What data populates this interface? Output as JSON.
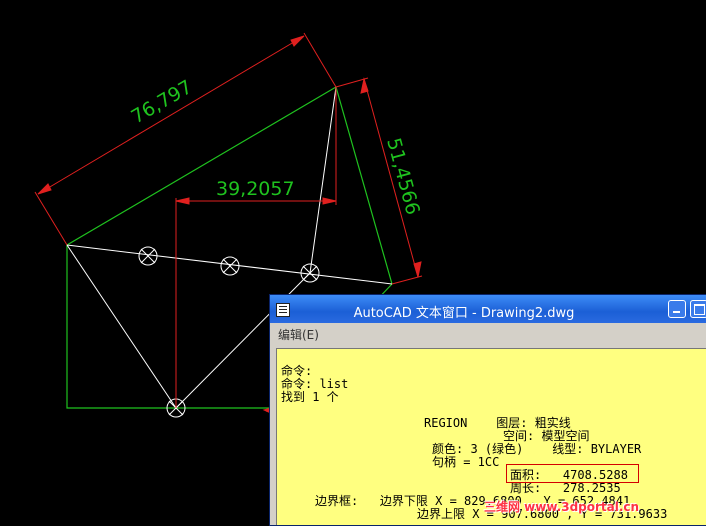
{
  "drawing": {
    "dimensions": {
      "long_side": "76,797",
      "short_side": "51,4566",
      "inner": "39,2057"
    }
  },
  "text_window": {
    "title": "AutoCAD 文本窗口 - Drawing2.dwg",
    "menu": {
      "edit": "编辑(E)"
    },
    "lines": [
      "命令:",
      "命令: list",
      "找到 1 个",
      "REGION    图层: 粗实线",
      "空间: 模型空间",
      "颜色: 3 (绿色)    线型: BYLAYER",
      "句柄 = 1CC",
      "面积:   4708.5288",
      "周长:   278.2535",
      "边界框:   边界下限 X = 829.6800 , Y = 652.4841",
      "边界上限 X = 907.6800 , Y = 731.9633"
    ]
  },
  "watermark": "三维网 www.3dportal.cn",
  "colors": {
    "background": "#000000",
    "geometry": "#1fc21f",
    "dimension": "#e0201f",
    "construction": "#ffffff",
    "text_bg": "#ffff80",
    "titlebar": "#2a6ae0",
    "highlight": "#d40000"
  }
}
